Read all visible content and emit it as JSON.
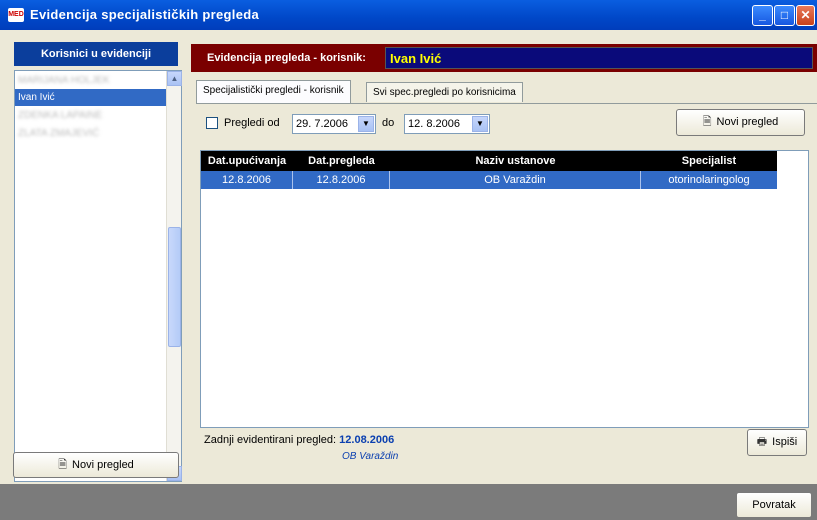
{
  "window": {
    "title": "Evidencija specijalističkih pregleda",
    "app_icon_text": "MED"
  },
  "left": {
    "header": "Korisnici u evidenciji",
    "users": [
      {
        "label": "MARIJANA HOLJEK",
        "blurred": true
      },
      {
        "label": "Ivan Ivić",
        "selected": true
      },
      {
        "label": "ZDENKA LAPAINE",
        "blurred": true
      },
      {
        "label": "ZLATA ZMAJEVIĆ",
        "blurred": true
      }
    ],
    "new_button": "Novi pregled"
  },
  "right": {
    "user_label": "Evidencija pregleda - korisnik:",
    "user_name": "Ivan Ivić",
    "tabs": [
      {
        "label": "Specijalistički pregledi - korisnik",
        "active": true
      },
      {
        "label": "Svi spec.pregledi po korisnicima",
        "active": false
      }
    ],
    "filter": {
      "checkbox_label": "Pregledi od",
      "from_date": "29. 7.2006",
      "to_label": "do",
      "to_date": "12. 8.2006"
    },
    "new_button": "Novi pregled",
    "table": {
      "columns": [
        "Dat.upućivanja",
        "Dat.pregleda",
        "Naziv ustanove",
        "Specijalist"
      ],
      "rows": [
        [
          "12.8.2006",
          "12.8.2006",
          "OB Varaždin",
          "otorinolaringolog"
        ]
      ]
    },
    "last_label": "Zadnji evidentirani pregled:",
    "last_date": "12.08.2006",
    "last_place": "OB Varaždin",
    "print_button": "Ispiši"
  },
  "footer": {
    "back_button": "Povratak"
  }
}
